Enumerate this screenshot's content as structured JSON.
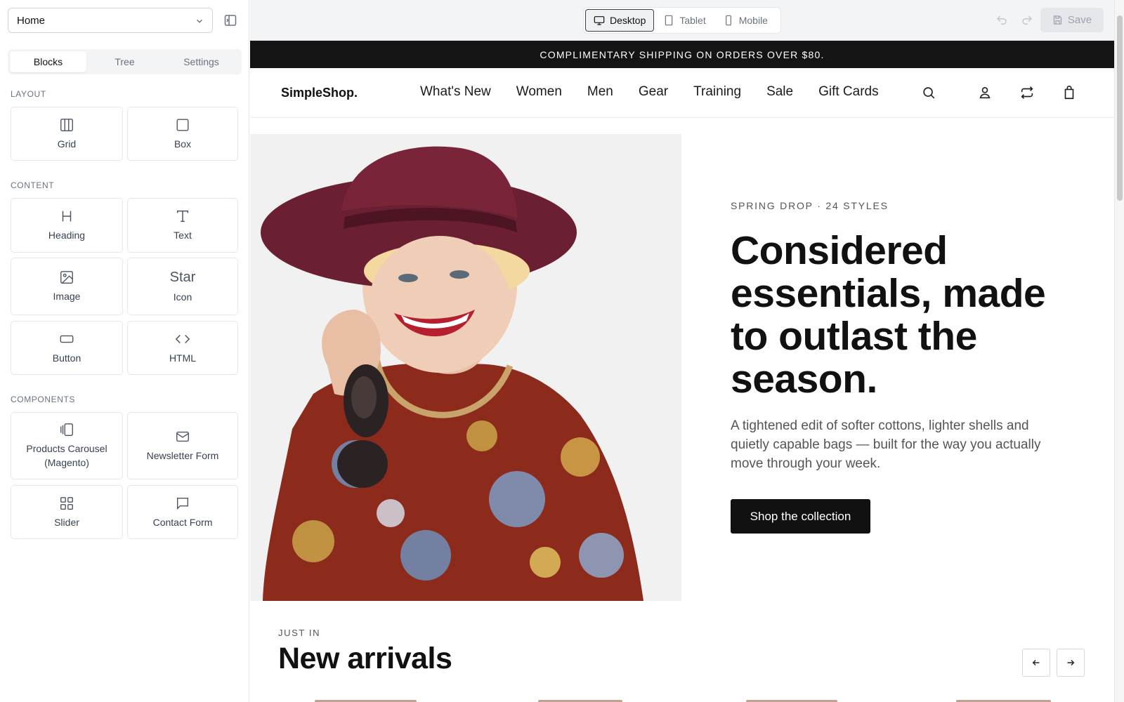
{
  "editor": {
    "page_select": {
      "value": "Home"
    },
    "tabs": [
      {
        "label": "Blocks",
        "active": true
      },
      {
        "label": "Tree",
        "active": false
      },
      {
        "label": "Settings",
        "active": false
      }
    ],
    "sections": {
      "layout": {
        "label": "LAYOUT",
        "blocks": [
          {
            "label": "Grid",
            "icon": "grid-columns-icon"
          },
          {
            "label": "Box",
            "icon": "box-icon"
          }
        ]
      },
      "content": {
        "label": "CONTENT",
        "blocks": [
          {
            "label": "Heading",
            "icon": "heading-icon"
          },
          {
            "label": "Text",
            "icon": "text-icon"
          },
          {
            "label": "Image",
            "icon": "image-icon"
          },
          {
            "label": "Icon",
            "icon": "star-icon",
            "icon_text": "Star"
          },
          {
            "label": "Button",
            "icon": "button-icon"
          },
          {
            "label": "HTML",
            "icon": "code-icon"
          }
        ]
      },
      "components": {
        "label": "COMPONENTS",
        "blocks": [
          {
            "label": "Products Carousel (Magento)",
            "icon": "carousel-icon"
          },
          {
            "label": "Newsletter Form",
            "icon": "mail-icon"
          },
          {
            "label": "Slider",
            "icon": "slider-icon"
          },
          {
            "label": "Contact Form",
            "icon": "message-icon"
          }
        ]
      }
    }
  },
  "toolbar": {
    "devices": [
      {
        "label": "Desktop",
        "icon": "monitor-icon",
        "active": true
      },
      {
        "label": "Tablet",
        "icon": "tablet-icon",
        "active": false
      },
      {
        "label": "Mobile",
        "icon": "phone-icon",
        "active": false
      }
    ],
    "undo_icon": "undo-icon",
    "redo_icon": "redo-icon",
    "save_label": "Save"
  },
  "site": {
    "announcement": "COMPLIMENTARY SHIPPING ON ORDERS OVER $80.",
    "logo": "SimpleShop.",
    "nav": [
      "What's New",
      "Women",
      "Men",
      "Gear",
      "Training",
      "Sale",
      "Gift Cards"
    ],
    "nav_icons": [
      "search-icon",
      "account-icon",
      "exchange-icon",
      "bag-icon"
    ],
    "hero": {
      "eyebrow": "SPRING DROP · 24 STYLES",
      "headline": "Considered essentials, made to outlast the season.",
      "body": "A tightened edit of softer cottons, lighter shells and quietly capable bags — built for the way you actually move through your week.",
      "cta": "Shop the collection"
    },
    "arrivals": {
      "eyebrow": "JUST IN",
      "title": "New arrivals"
    }
  },
  "colors": {
    "announcement_bg": "#141414",
    "cta_bg": "#111111",
    "hat": "#6b1f33",
    "shirt": "#8c2a1c"
  }
}
